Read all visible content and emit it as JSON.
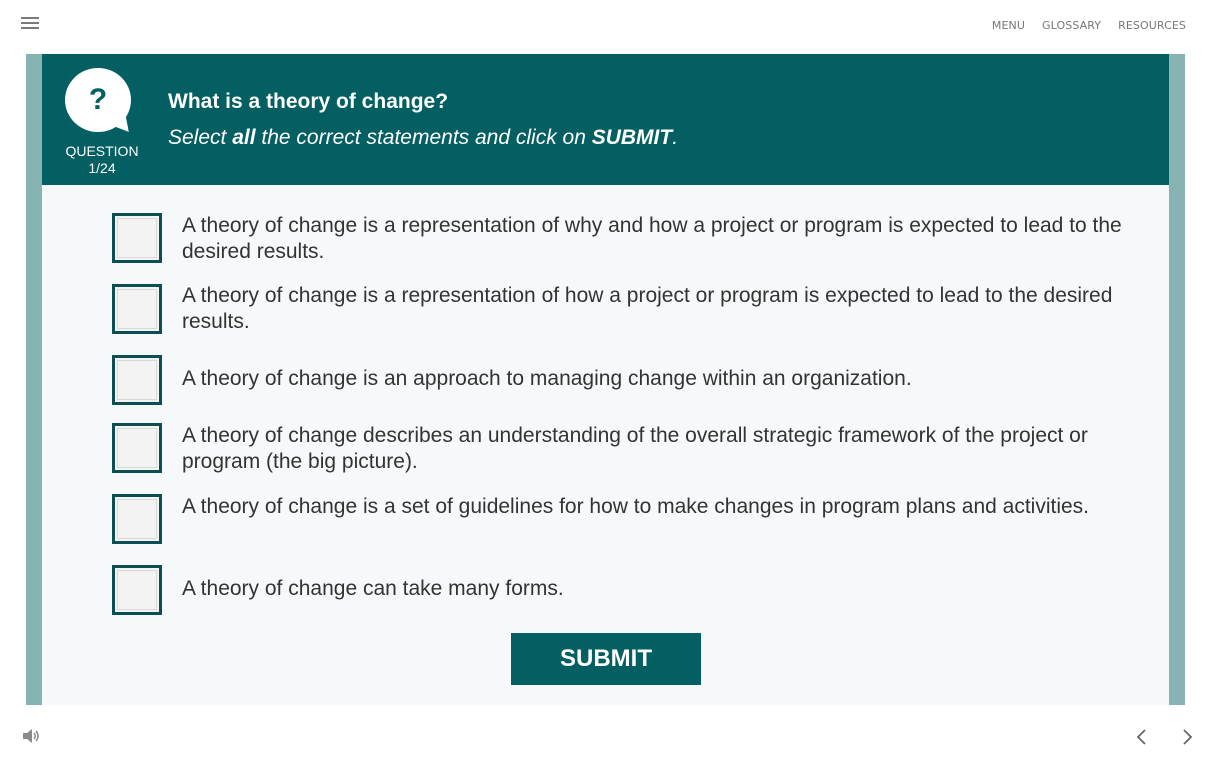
{
  "topnav": {
    "menu": "MENU",
    "glossary": "GLOSSARY",
    "resources": "RESOURCES"
  },
  "question": {
    "icon_glyph": "?",
    "label": "QUESTION",
    "counter": "1/24",
    "title": "What is a theory of change?",
    "instruction": {
      "part1": "Select ",
      "emph1": "all",
      "part2": " the correct statements and click on ",
      "emph2": "SUBMIT",
      "part3": "."
    }
  },
  "options": [
    {
      "text": "A theory of change is a representation of why and how a project or program is expected to lead to the desired results.",
      "checked": false
    },
    {
      "text": "A theory of change is a representation of how a project or program is expected to lead to the desired results.",
      "checked": false
    },
    {
      "text": "A theory of change is an approach to managing change within an organization.",
      "checked": false
    },
    {
      "text": "A theory of change describes an understanding of the overall strategic framework of the project or program (the big picture).",
      "checked": false
    },
    {
      "text": "A theory of change is a set of guidelines for how to make changes in program plans and activities.",
      "checked": false
    },
    {
      "text": "A theory of change can take many forms.",
      "checked": false
    }
  ],
  "submit_label": "SUBMIT",
  "icons": {
    "menu": "hamburger-icon",
    "audio": "speaker-icon",
    "prev": "chevron-left-icon",
    "next": "chevron-right-icon"
  },
  "colors": {
    "accent": "#035f61",
    "frame": "#87b4b3",
    "content_bg": "#f5f9fa",
    "checkbox_border": "#0b4f52",
    "text": "#333333"
  }
}
